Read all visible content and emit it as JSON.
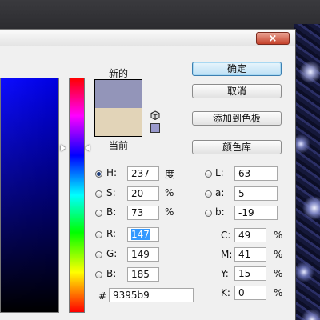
{
  "dialog": {
    "close_label": "×",
    "new_label": "新的",
    "current_label": "当前",
    "new_color": "#9395b9",
    "current_color": "#e2d4b8",
    "websafe_color": "#9999cc"
  },
  "buttons": {
    "ok": "确定",
    "cancel": "取消",
    "add_to_swatches": "添加到色板",
    "color_libraries": "颜色库"
  },
  "hsb": {
    "h_label": "H:",
    "h": "237",
    "h_unit": "度",
    "s_label": "S:",
    "s": "20",
    "s_unit": "%",
    "b_label": "B:",
    "b": "73",
    "b_unit": "%"
  },
  "rgb": {
    "r_label": "R:",
    "r": "147",
    "g_label": "G:",
    "g": "149",
    "b_label": "B:",
    "b": "185"
  },
  "lab": {
    "l_label": "L:",
    "l": "63",
    "a_label": "a:",
    "a": "5",
    "b_label": "b:",
    "b": "-19"
  },
  "cmyk": {
    "c_label": "C:",
    "c": "49",
    "c_unit": "%",
    "m_label": "M:",
    "m": "41",
    "m_unit": "%",
    "y_label": "Y:",
    "y": "15",
    "y_unit": "%",
    "k_label": "K:",
    "k": "0",
    "k_unit": "%"
  },
  "hex": {
    "label": "#",
    "value": "9395b9"
  }
}
